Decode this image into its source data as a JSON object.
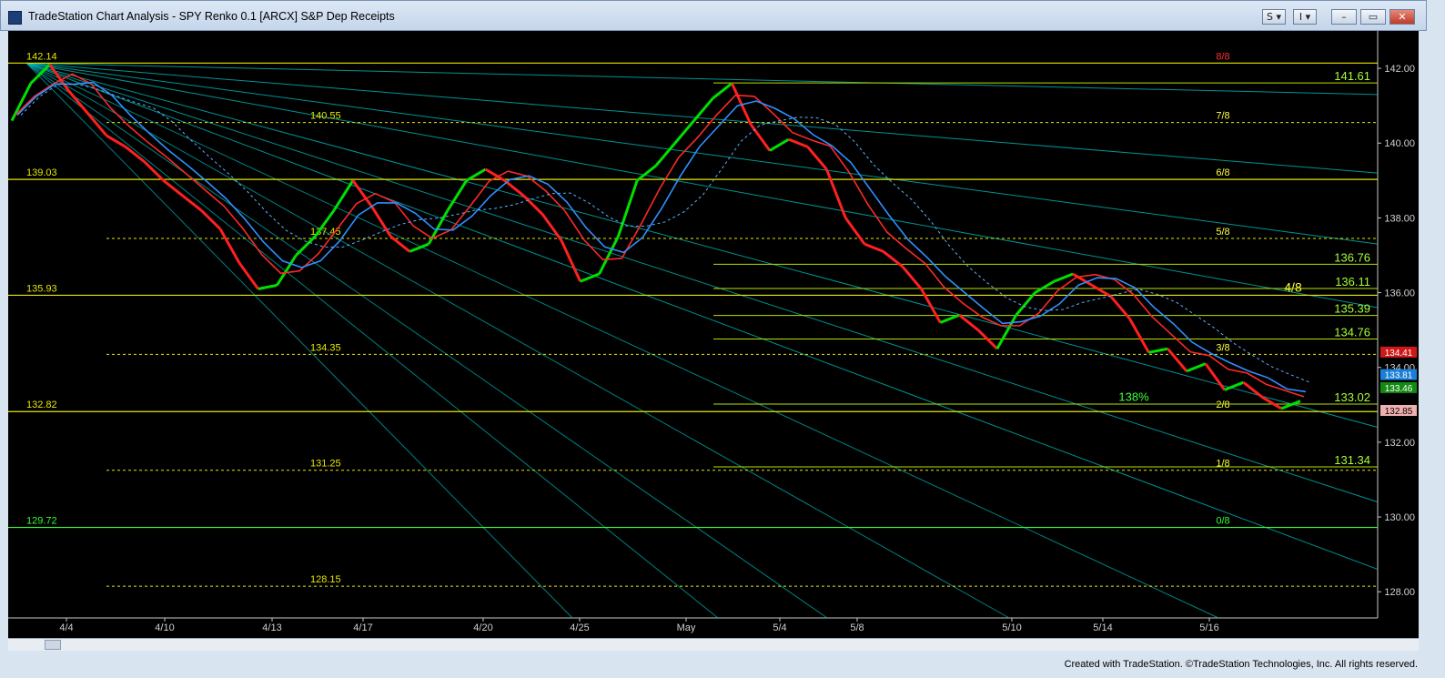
{
  "window": {
    "title": "TradeStation Chart Analysis - SPY Renko 0.1 [ARCX] S&P Dep Receipts",
    "buttons": [
      "S",
      "I"
    ]
  },
  "footer": {
    "credit": "Created with TradeStation. ©TradeStation Technologies, Inc. All rights reserved."
  },
  "colors": {
    "background": "#000000",
    "price_up": "#00e000",
    "price_down": "#ff2020",
    "level_line": "#e6e600",
    "fan_line": "#00b8b8"
  },
  "chart_data": {
    "type": "line",
    "x": [
      "4/4",
      "4/10",
      "4/13",
      "4/17",
      "4/20",
      "4/25",
      "May",
      "5/4",
      "5/8",
      "5/10",
      "5/14",
      "5/16"
    ],
    "ylim": [
      127.3,
      143.0
    ],
    "yticks": [
      142.0,
      140.0,
      138.0,
      136.0,
      134.0,
      132.0,
      130.0,
      128.0
    ],
    "ytick_labels": [
      "142.00",
      "140.00",
      "138.00",
      "136.00",
      "134.00",
      "132.00",
      "130.00",
      "128.00"
    ],
    "grid": false,
    "series": [
      {
        "values": [
          140.6,
          141.6,
          142.1,
          141.4,
          140.8,
          140.2,
          139.9,
          139.5,
          139.0,
          138.6,
          138.2,
          137.7,
          136.8,
          136.1,
          136.2,
          137.0,
          137.5,
          138.2,
          139.0,
          138.3,
          137.5,
          137.1,
          137.3,
          138.2,
          139.0,
          139.3,
          139.0,
          138.6,
          138.1,
          137.4,
          136.3,
          136.5,
          137.5,
          139.0,
          139.4,
          140.0,
          140.6,
          141.2,
          141.6,
          140.5,
          139.8,
          140.1,
          139.9,
          139.3,
          138.0,
          137.3,
          137.1,
          136.7,
          136.1,
          135.2,
          135.4,
          135.0,
          134.5,
          135.4,
          136.0,
          136.3,
          136.5,
          136.2,
          135.9,
          135.3,
          134.4,
          134.5,
          133.9,
          134.1,
          133.4,
          133.6,
          133.2,
          132.9,
          133.1
        ]
      }
    ],
    "levels": [
      {
        "value": 142.14,
        "label": "142.14",
        "murrey": "8/8"
      },
      {
        "value": 140.55,
        "label": "140.55",
        "murrey": "7/8"
      },
      {
        "value": 139.03,
        "label": "139.03",
        "murrey": "6/8"
      },
      {
        "value": 137.45,
        "label": "137.45",
        "murrey": "5/8"
      },
      {
        "value": 135.93,
        "label": "135.93",
        "murrey": "4/8"
      },
      {
        "value": 134.35,
        "label": "134.35",
        "murrey": "3/8"
      },
      {
        "value": 132.82,
        "label": "132.82",
        "murrey": "2/8"
      },
      {
        "value": 131.25,
        "label": "131.25",
        "murrey": "1/8"
      },
      {
        "value": 129.72,
        "label": "129.72",
        "murrey": "0/8"
      },
      {
        "value": 128.15,
        "label": "128.15",
        "murrey": ""
      }
    ],
    "projections": [
      {
        "value": 141.61,
        "label": "141.61"
      },
      {
        "value": 136.76,
        "label": "136.76"
      },
      {
        "value": 136.11,
        "label": "136.11"
      },
      {
        "value": 135.39,
        "label": "135.39"
      },
      {
        "value": 134.76,
        "label": "134.76"
      },
      {
        "value": 133.02,
        "label": "133.02"
      },
      {
        "value": 131.34,
        "label": "131.34"
      }
    ],
    "annotations": [
      "138%"
    ],
    "price_tags": [
      {
        "value": 134.41,
        "label": "134.41",
        "color": "#d01818"
      },
      {
        "value": 133.81,
        "label": "133.81",
        "color": "#1a7fd8"
      },
      {
        "value": 133.46,
        "label": "133.46",
        "color": "#138a13"
      },
      {
        "value": 132.85,
        "label": "132.85",
        "color": "#f0b0b0"
      }
    ]
  }
}
